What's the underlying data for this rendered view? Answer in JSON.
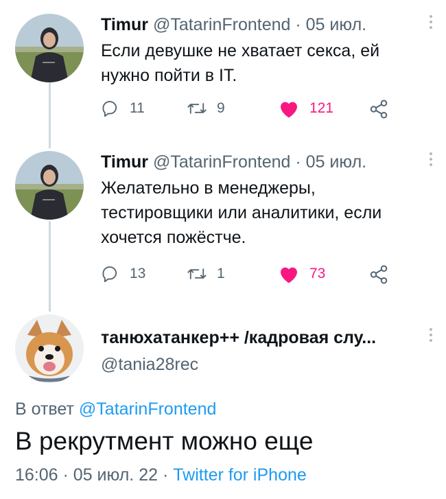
{
  "tweets": [
    {
      "name": "Timur",
      "handle": "@TatarinFrontend",
      "separator": "·",
      "date": "05 июл.",
      "text_lines": [
        "Если девушке не хватает секса, ей",
        "нужно пойти в IT."
      ],
      "replies": "11",
      "retweets": "9",
      "likes": "121"
    },
    {
      "name": "Timur",
      "handle": "@TatarinFrontend",
      "separator": "·",
      "date": "05 июл.",
      "text_lines": [
        "Желательно в менеджеры,",
        "тестировщики или аналитики, если",
        "хочется пожёстче."
      ],
      "replies": "13",
      "retweets": "1",
      "likes": "73"
    }
  ],
  "main_tweet": {
    "name": "танюхатанкер++ /кадровая слу...",
    "handle": "@tania28rec",
    "reply_prefix": "В ответ",
    "reply_to": "@TatarinFrontend",
    "text": "В рекрутмент можно еще",
    "time": "16:06",
    "separator": "·",
    "date": "05 июл. 22",
    "source_separator": "·",
    "source": "Twitter for iPhone"
  },
  "colors": {
    "text": "#0f1419",
    "secondary": "#536471",
    "like": "#f91880",
    "link": "#1d9bf0",
    "thread_line": "#cfd9de"
  },
  "icons": [
    "reply-icon",
    "retweet-icon",
    "like-icon",
    "share-icon",
    "more-icon"
  ]
}
